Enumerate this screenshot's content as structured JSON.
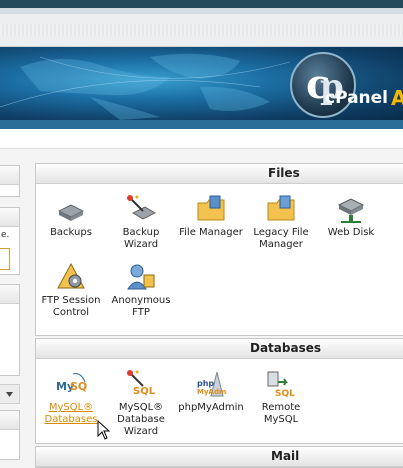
{
  "banner": {
    "logo_text": "cPanel",
    "logo_suffix": "A"
  },
  "panels": {
    "files": {
      "title": "Files",
      "items": [
        {
          "label": "Backups",
          "icon": "backups-icon"
        },
        {
          "label": "Backup Wizard",
          "icon": "backup-wizard-icon"
        },
        {
          "label": "File Manager",
          "icon": "file-manager-icon"
        },
        {
          "label": "Legacy File Manager",
          "icon": "legacy-file-manager-icon"
        },
        {
          "label": "Web Disk",
          "icon": "web-disk-icon"
        },
        {
          "label": "FTP Session Control",
          "icon": "ftp-session-icon"
        },
        {
          "label": "Anonymous FTP",
          "icon": "anonymous-ftp-icon"
        }
      ]
    },
    "databases": {
      "title": "Databases",
      "items": [
        {
          "label": "MySQL® Databases",
          "icon": "mysql-icon"
        },
        {
          "label": "MySQL® Database Wizard",
          "icon": "mysql-wizard-icon"
        },
        {
          "label": "phpMyAdmin",
          "icon": "phpmyadmin-icon"
        },
        {
          "label": "Remote MySQL",
          "icon": "remote-mysql-icon"
        }
      ]
    },
    "mail": {
      "title": "Mail"
    }
  },
  "sidebar": {
    "snippet": "e."
  },
  "colors": {
    "header": "#244a5c",
    "link_selected": "#d98a00",
    "banner": "#1b6ea3"
  }
}
